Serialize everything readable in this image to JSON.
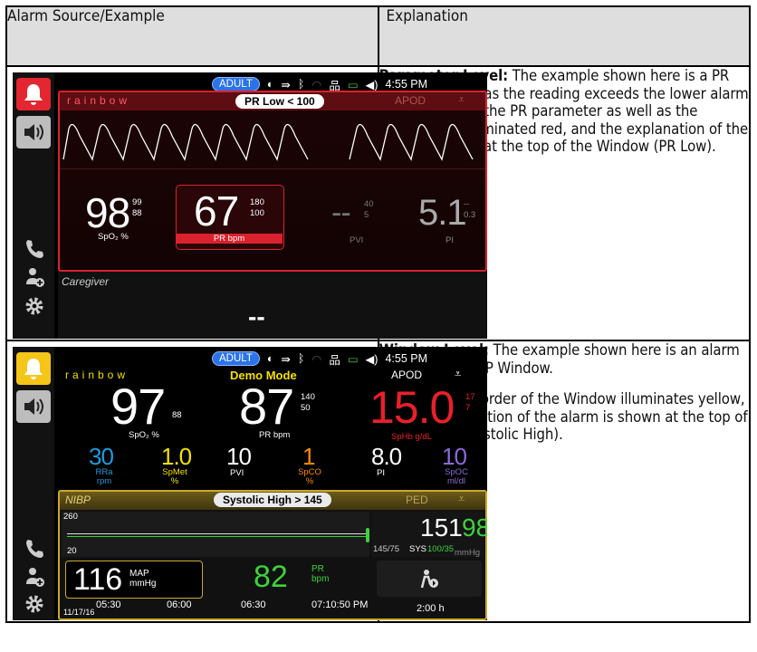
{
  "table": {
    "header_left": "Alarm Source/Example",
    "header_right": "Explanation"
  },
  "row1": {
    "heading": "Parameter Level:",
    "body": "The example shown here is a PR alarm (PR Low) as the reading exceeds the lower alarm limit. Note that the PR parameter as well as the Window are illuminated red, and the explanation of the alarm is shown at the top of the Window (PR Low)."
  },
  "row2": {
    "heading": "Window Level:",
    "body1": "The example shown here is an alarm in the lower NIBP Window.",
    "body2": "Note that the border of the Window illuminates yellow, and the explanation of the alarm is shown at the top of the Window (Systolic High)."
  },
  "screen1": {
    "mode": "ADULT",
    "time": "4:55 PM",
    "brand": "rainbow",
    "alarm": "PR Low < 100",
    "apod": "APOD",
    "spo2": "98",
    "spo2_hi": "99",
    "spo2_lo": "88",
    "spo2_lbl": "SpO₂ %",
    "pr": "67",
    "pr_hi": "180",
    "pr_lo": "100",
    "pr_lbl": "PR bpm",
    "pvi": "--",
    "pvi_hi": "40",
    "pvi_lo": "5",
    "pvi_lbl": "PVI",
    "pi": "5.1",
    "pi_hi": "--",
    "pi_lo": "0.3",
    "pi_lbl": "PI",
    "caregiver": "Caregiver",
    "caregiver_val": "--"
  },
  "screen2": {
    "mode": "ADULT",
    "time": "4:55 PM",
    "brand": "rainbow",
    "title": "Demo Mode",
    "apod": "APOD",
    "spo2": "97",
    "spo2_lo": "88",
    "spo2_lbl": "SpO₂ %",
    "pr": "87",
    "pr_hi": "140",
    "pr_lo": "50",
    "pr_lbl": "PR bpm",
    "sphb": "15.0",
    "sphb_hi": "17",
    "sphb_lo": "7",
    "sphb_lbl": "SpHb g/dL",
    "rra": "30",
    "rra_lbl": "RRa rpm",
    "spmet": "1.0",
    "spmet_lbl": "SpMet %",
    "pvi": "10",
    "pvi_lbl": "PVI",
    "spco": "1",
    "spco_lbl": "SpCO %",
    "pi": "8.0",
    "pi_lbl": "PI",
    "spoc": "10",
    "spoc_lbl": "SpOC ml/dl",
    "nibp": "NIBP",
    "alarm": "Systolic High > 145",
    "ped": "PED",
    "y_hi": "260",
    "y_lo": "20",
    "range": "145/75",
    "sys_lbl": "SYS",
    "sys_range": "100/35",
    "sys": "151",
    "dia": "98",
    "mmhg": "mmHg",
    "map": "116",
    "map_lbl": "MAP mmHg",
    "pr2": "82",
    "pr2_lbl": "PR bpm",
    "t1": "05:30",
    "t2": "06:00",
    "t3": "06:30",
    "t4": "07:10:50 PM",
    "date": "11/17/16",
    "interval": "2:00 h"
  },
  "colors": {
    "red_alarm": "#d9222e",
    "yellow_alarm": "#f5c518",
    "spo2": "#ffffff",
    "pr_green": "#3dd13d",
    "sphb_red": "#e8202a",
    "rra_blue": "#1e9be0",
    "spmet_yellow": "#f3e000",
    "spco_orange": "#ff8a00",
    "spoc_purple": "#8c6ad6",
    "adult_blue": "#2a73e8"
  }
}
